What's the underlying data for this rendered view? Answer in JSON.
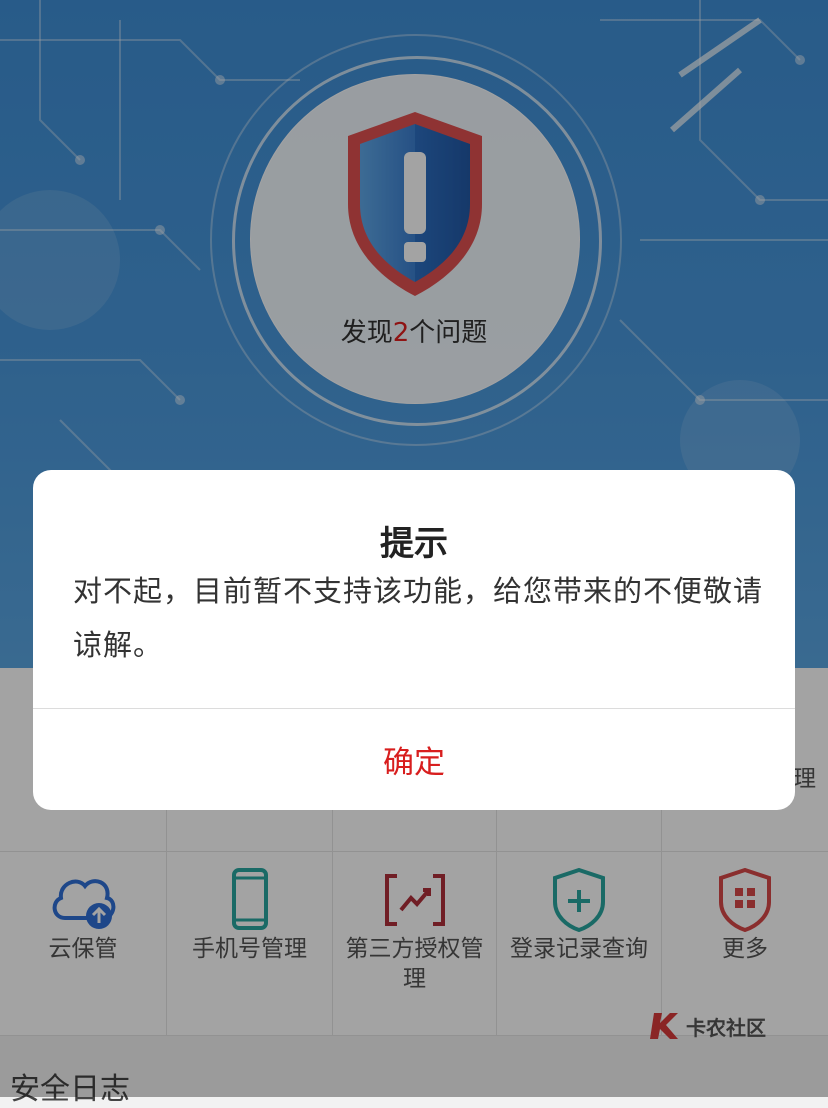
{
  "hero": {
    "found_prefix": "发现",
    "found_count": "2",
    "found_suffix": "个问题",
    "shield_icon": "shield-exclamation-icon"
  },
  "grid": {
    "row1": [
      {
        "label": "",
        "icon": "blank"
      },
      {
        "label": "",
        "icon": "blank"
      },
      {
        "label": "",
        "icon": "blank"
      },
      {
        "label": "",
        "icon": "blank"
      },
      {
        "label": "理",
        "icon": "blank"
      }
    ],
    "row2": [
      {
        "label": "云保管",
        "icon": "cloud-upload-icon"
      },
      {
        "label": "手机号管理",
        "icon": "phone-icon"
      },
      {
        "label": "第三方授权管理",
        "icon": "third-party-auth-icon"
      },
      {
        "label": "登录记录查询",
        "icon": "shield-plus-icon"
      },
      {
        "label": "更多",
        "icon": "more-grid-icon"
      }
    ]
  },
  "section": {
    "title": "安全日志"
  },
  "watermark": {
    "text": "卡农社区"
  },
  "dialog": {
    "title": "提示",
    "message": "对不起，目前暂不支持该功能，给您带来的不便敬请谅解。",
    "confirm_label": "确定"
  },
  "colors": {
    "accent_red": "#d81e1e",
    "hero_blue": "#4a98dc",
    "icon_blue": "#2f6fd6",
    "icon_teal": "#2aa7a0"
  }
}
